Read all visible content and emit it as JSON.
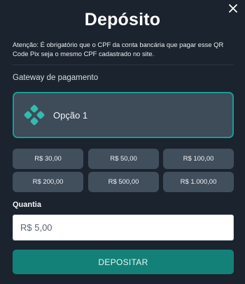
{
  "modal": {
    "title": "Depósito",
    "close_icon": "close-icon",
    "notice": "Atenção: É obrigatório que o CPF da conta bancária que pagar esse QR Code Pix seja o mesmo CPF cadastrado no site."
  },
  "gateway": {
    "label": "Gateway de pagamento",
    "selected_option": "Opção 1",
    "icon": "pix-icon"
  },
  "amounts": [
    "R$ 30,00",
    "R$ 50,00",
    "R$ 100,00",
    "R$ 200,00",
    "R$ 500,00",
    "R$ 1.000,00"
  ],
  "quantity": {
    "label": "Quantia",
    "value": "R$ 5,00"
  },
  "submit_label": "DEPOSITAR",
  "colors": {
    "background": "#1b232e",
    "accent": "#138178",
    "selected_border": "#1a9b93",
    "button_bg": "#414e5c",
    "pix_icon": "#32bcad"
  }
}
